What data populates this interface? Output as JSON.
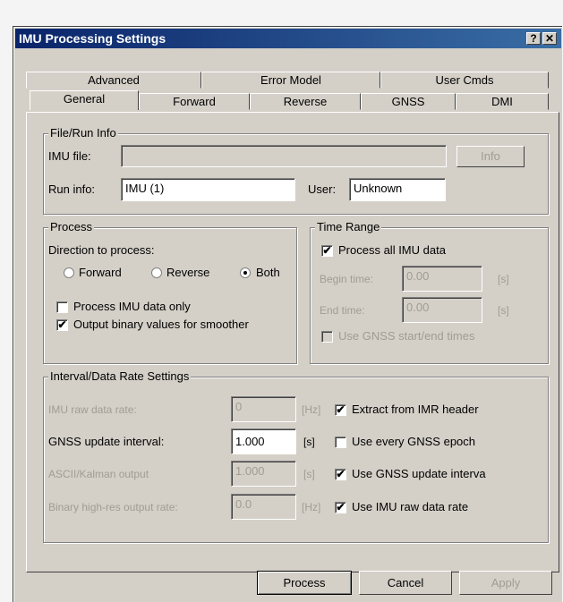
{
  "window": {
    "title": "IMU Processing Settings",
    "help_icon_label": "?",
    "close_icon_label": "✕"
  },
  "tabs": {
    "row1": [
      "Advanced",
      "Error Model",
      "User Cmds"
    ],
    "row2": [
      "General",
      "Forward",
      "Reverse",
      "GNSS",
      "DMI"
    ],
    "selected": "General"
  },
  "file_run": {
    "legend": "File/Run Info",
    "imu_file_label": "IMU file:",
    "imu_file_value": "",
    "info_button": "Info",
    "run_info_label": "Run info:",
    "run_info_value": "IMU (1)",
    "user_label": "User:",
    "user_value": "Unknown"
  },
  "process": {
    "legend": "Process",
    "direction_label": "Direction to process:",
    "radio_forward": "Forward",
    "radio_reverse": "Reverse",
    "radio_both": "Both",
    "selected_direction": "Both",
    "imu_only_label": "Process IMU data only",
    "imu_only_checked": false,
    "binary_label": "Output binary values for smoother",
    "binary_checked": true
  },
  "time_range": {
    "legend": "Time Range",
    "process_all_label": "Process all IMU data",
    "process_all_checked": true,
    "begin_label": "Begin time:",
    "begin_value": "0.00",
    "begin_unit": "[s]",
    "end_label": "End time:",
    "end_value": "0.00",
    "end_unit": "[s]",
    "gnss_times_label": "Use GNSS start/end times",
    "gnss_times_checked": false
  },
  "interval": {
    "legend": "Interval/Data Rate Settings",
    "raw_rate_label": "IMU raw data rate:",
    "raw_rate_value": "0",
    "raw_rate_unit": "[Hz]",
    "extract_label": "Extract from IMR header",
    "extract_checked": true,
    "gnss_interval_label": "GNSS update interval:",
    "gnss_interval_value": "1.000",
    "gnss_interval_unit": "[s]",
    "every_epoch_label": "Use every GNSS epoch",
    "every_epoch_checked": false,
    "ascii_label": "ASCII/Kalman output",
    "ascii_value": "1.000",
    "ascii_unit": "[s]",
    "use_gnss_interval_label": "Use GNSS update interva",
    "use_gnss_interval_checked": true,
    "binary_rate_label": "Binary high-res output rate:",
    "binary_rate_value": "0.0",
    "binary_rate_unit": "[Hz]",
    "use_raw_rate_label": "Use IMU raw data rate",
    "use_raw_rate_checked": true
  },
  "buttons": {
    "process": "Process",
    "cancel": "Cancel",
    "apply": "Apply"
  },
  "check_glyph": "✔"
}
